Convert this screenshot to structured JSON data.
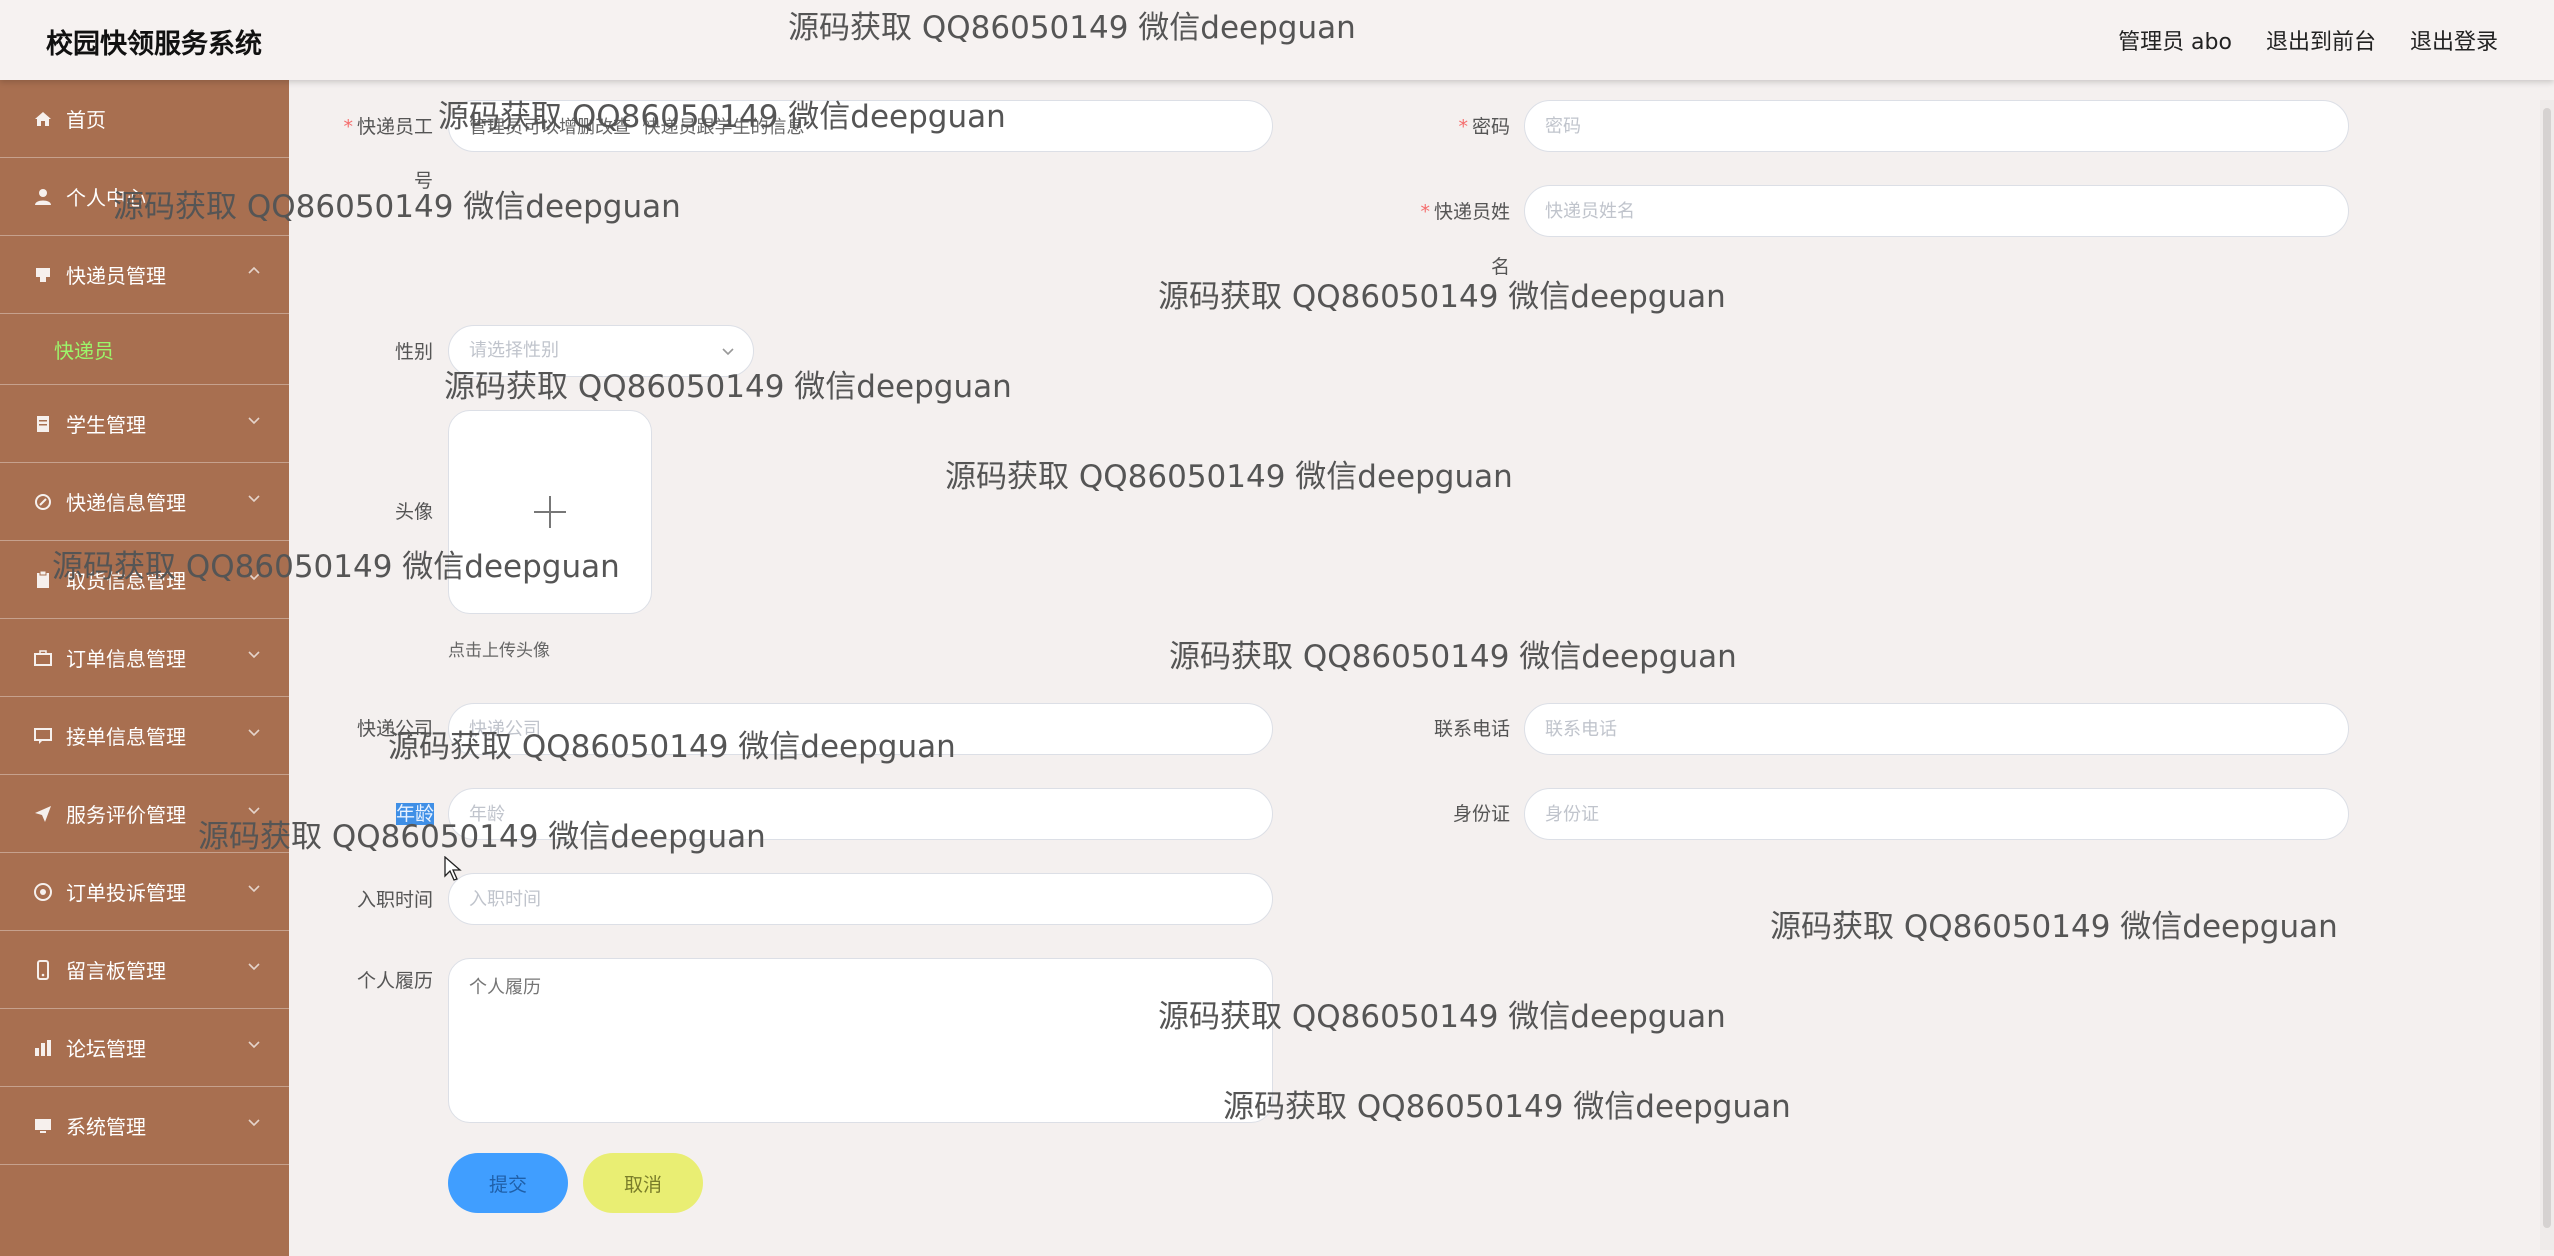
{
  "header": {
    "app_title": "校园快领服务系统",
    "user_label": "管理员 abo",
    "front_label": "退出到前台",
    "logout_label": "退出登录"
  },
  "sidebar": {
    "items": [
      {
        "label": "首页",
        "icon": "home-icon"
      },
      {
        "label": "个人中心",
        "icon": "user-icon"
      },
      {
        "label": "快递员管理",
        "icon": "courier-icon"
      },
      {
        "label": "学生管理",
        "icon": "student-icon"
      },
      {
        "label": "快递信息管理",
        "icon": "package-icon"
      },
      {
        "label": "取货信息管理",
        "icon": "clipboard-icon"
      },
      {
        "label": "订单信息管理",
        "icon": "briefcase-icon"
      },
      {
        "label": "接单信息管理",
        "icon": "chat-icon"
      },
      {
        "label": "服务评价管理",
        "icon": "send-icon"
      },
      {
        "label": "订单投诉管理",
        "icon": "target-icon"
      },
      {
        "label": "留言板管理",
        "icon": "phone-icon"
      },
      {
        "label": "论坛管理",
        "icon": "chart-icon"
      },
      {
        "label": "系统管理",
        "icon": "monitor-icon"
      }
    ],
    "sub_item": "快递员"
  },
  "form": {
    "courier_no_label_line1": "快递员工",
    "courier_no_label_line2": "号",
    "courier_no_value": "管理员可以增删改查  快递员跟学生的信息",
    "password_label": "密码",
    "password_placeholder": "密码",
    "name_label_line1": "快递员姓",
    "name_label_line2": "名",
    "name_placeholder": "快递员姓名",
    "gender_label": "性别",
    "gender_placeholder": "请选择性别",
    "avatar_label": "头像",
    "avatar_hint": "点击上传头像",
    "company_label": "快递公司",
    "company_placeholder": "快递公司",
    "phone_label": "联系电话",
    "phone_placeholder": "联系电话",
    "age_label": "年龄",
    "age_placeholder": "年龄",
    "idcard_label": "身份证",
    "idcard_placeholder": "身份证",
    "hire_label": "入职时间",
    "hire_placeholder": "入职时间",
    "resume_label": "个人履历",
    "resume_placeholder": "个人履历",
    "submit_label": "提交",
    "cancel_label": "取消"
  },
  "watermark_text": "源码获取 QQ86050149 微信deepguan"
}
